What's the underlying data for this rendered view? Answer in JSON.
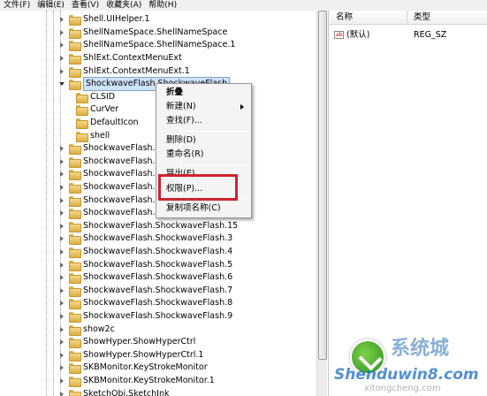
{
  "menubar": {
    "items": [
      "文件(F)",
      "编辑(E)",
      "查看(V)",
      "收藏夹(A)",
      "帮助(H)"
    ]
  },
  "tree": {
    "items_above": [
      "Shell.UIHelper.1",
      "ShellNameSpace.ShellNameSpace",
      "ShellNameSpace.ShellNameSpace.1",
      "ShlExt.ContextMenuExt",
      "ShlExt.ContextMenuExt.1"
    ],
    "selected": "ShockwaveFlash.ShockwaveFlash",
    "children": [
      "CLSID",
      "CurVer",
      "DefaultIcon",
      "shell"
    ],
    "items_obscured": [
      "ShockwaveFlash.S",
      "ShockwaveFlash.S",
      "ShockwaveFlash.S",
      "ShockwaveFlash.S",
      "ShockwaveFlash.S",
      "ShockwaveFlash.S"
    ],
    "items_below": [
      "ShockwaveFlash.ShockwaveFlash.15",
      "ShockwaveFlash.ShockwaveFlash.3",
      "ShockwaveFlash.ShockwaveFlash.4",
      "ShockwaveFlash.ShockwaveFlash.5",
      "ShockwaveFlash.ShockwaveFlash.6",
      "ShockwaveFlash.ShockwaveFlash.7",
      "ShockwaveFlash.ShockwaveFlash.8",
      "ShockwaveFlash.ShockwaveFlash.9",
      "show2c",
      "ShowHyper.ShowHyperCtrl",
      "ShowHyper.ShowHyperCtrl.1",
      "SKBMonitor.KeyStrokeMonitor",
      "SKBMonitor.KeyStrokeMonitor.1",
      "SketchObj.SketchInk"
    ]
  },
  "values": {
    "col_name": "名称",
    "col_type": "类型",
    "rows": [
      {
        "icon": "ab",
        "name": "(默认)",
        "type": "REG_SZ"
      }
    ]
  },
  "context_menu": {
    "items": [
      {
        "label": "折叠",
        "bold": true
      },
      {
        "label": "新建(N)",
        "submenu": true
      },
      {
        "label": "查找(F)..."
      },
      {
        "label": "删除(D)"
      },
      {
        "label": "重命名(R)"
      },
      {
        "label": "导出(E)"
      },
      {
        "label": "权限(P)..."
      },
      {
        "label": "复制项名称(C)"
      }
    ],
    "highlighted": "权限(P)...",
    "highlight_color": "#d0232e"
  },
  "watermark": {
    "name": "Shenduwin8.com",
    "url": "xitongcheng.com",
    "cn": "系统城"
  }
}
